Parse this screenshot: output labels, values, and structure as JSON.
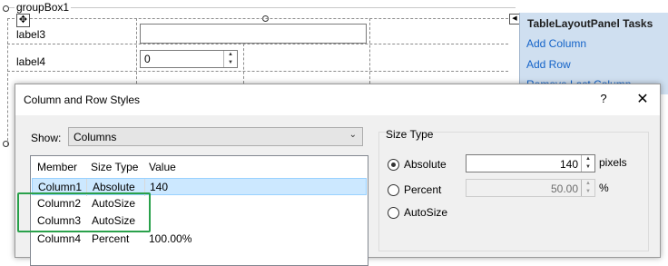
{
  "designer": {
    "groupbox_title": "groupBox1",
    "label3": "label3",
    "label4": "label4",
    "numeric_value": "0"
  },
  "tasks_panel": {
    "title": "TableLayoutPanel Tasks",
    "links": [
      "Add Column",
      "Add Row",
      "Remove Last Column"
    ]
  },
  "dialog": {
    "title": "Column and Row Styles",
    "help_glyph": "?",
    "close_glyph": "✕",
    "show_label": "Show:",
    "show_value": "Columns",
    "list": {
      "headers": [
        "Member",
        "Size Type",
        "Value"
      ],
      "rows": [
        {
          "member": "Column1",
          "size_type": "Absolute",
          "value": "140"
        },
        {
          "member": "Column2",
          "size_type": "AutoSize",
          "value": ""
        },
        {
          "member": "Column3",
          "size_type": "AutoSize",
          "value": ""
        },
        {
          "member": "Column4",
          "size_type": "Percent",
          "value": "100.00%"
        }
      ]
    },
    "size_type": {
      "title": "Size Type",
      "absolute_label": "Absolute",
      "absolute_value": "140",
      "absolute_unit": "pixels",
      "percent_label": "Percent",
      "percent_value": "50.00",
      "percent_unit": "%",
      "autosize_label": "AutoSize",
      "selected": "Absolute"
    }
  },
  "colors": {
    "selection_row": "#cce8ff",
    "highlight_border": "#2aa14b",
    "link": "#1463c8",
    "tasks_bg": "#cfdff0"
  }
}
